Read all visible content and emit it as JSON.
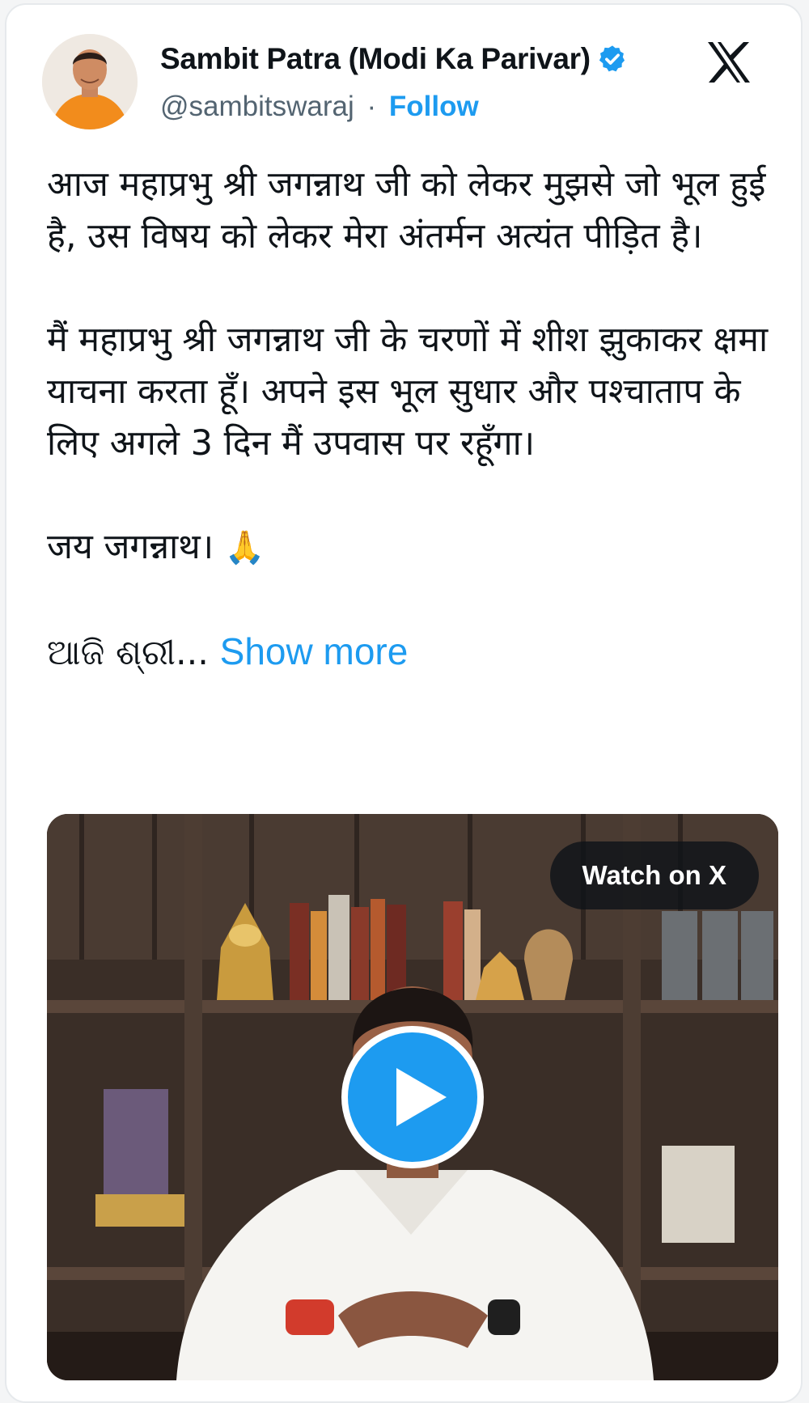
{
  "author": {
    "name": "Sambit Patra (Modi Ka Parivar)",
    "handle": "@sambitswaraj",
    "separator": "·",
    "follow_label": "Follow",
    "verified_icon": "verified-badge-icon",
    "avatar_icon": "avatar"
  },
  "brand": {
    "logo": "x-logo-icon"
  },
  "tweet": {
    "para1": "आज महाप्रभु श्री जगन्नाथ जी को लेकर मुझसे जो भूल हुई है, उस विषय को लेकर मेरा अंतर्मन अत्यंत पीड़ित है।",
    "para2": "मैं महाप्रभु श्री जगन्नाथ जी के चरणों में शीश झुकाकर क्षमा याचना करता हूँ। अपने इस भूल सुधार और पश्चाताप के लिए अगले 3 दिन मैं उपवास पर रहूँगा।",
    "para3": "जय जगन्नाथ।",
    "emoji": "🙏",
    "truncated": "ଆଜି ଶ୍ରୀ...",
    "show_more": "Show more"
  },
  "media": {
    "watch_label": "Watch on X",
    "play_icon": "play-icon"
  },
  "colors": {
    "accent": "#1d9bf0",
    "text": "#0f1419",
    "secondary": "#536471"
  }
}
